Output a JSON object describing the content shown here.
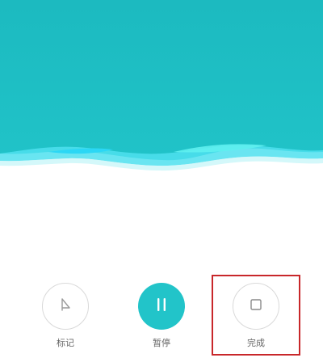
{
  "colors": {
    "accent": "#22c4c9",
    "wave_light": "#4fe0ee",
    "wave_bright": "#2bd7f5",
    "background": "#ffffff",
    "label": "#666666",
    "highlight": "#c8272a"
  },
  "controls": {
    "mark": {
      "label": "标记",
      "icon": "flag-icon"
    },
    "pause": {
      "label": "暂停",
      "icon": "pause-icon"
    },
    "done": {
      "label": "完成",
      "icon": "stop-icon"
    }
  }
}
